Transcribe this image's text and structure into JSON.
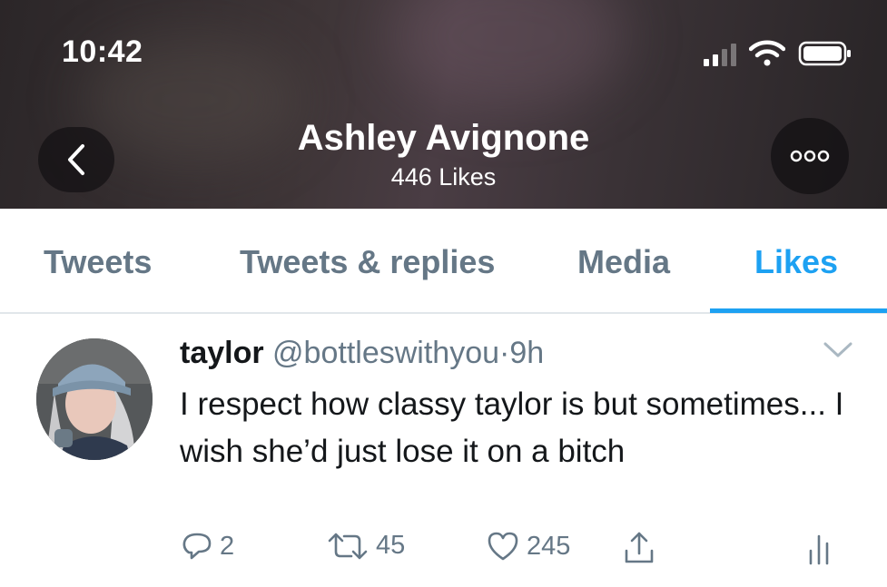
{
  "status_bar": {
    "time": "10:42"
  },
  "header": {
    "profile_name": "Ashley Avignone",
    "likes_count": "446 Likes"
  },
  "tabs": [
    {
      "label": "Tweets",
      "active": false
    },
    {
      "label": "Tweets & replies",
      "active": false
    },
    {
      "label": "Media",
      "active": false
    },
    {
      "label": "Likes",
      "active": true
    }
  ],
  "tweet": {
    "author_name": "taylor",
    "handle": "@bottleswithyou",
    "separator": "·",
    "time": "9h",
    "text": "I respect how classy taylor is but sometimes... I wish she’d just lose it on a bitch",
    "reply_count": "2",
    "retweet_count": "45",
    "like_count": "245"
  },
  "colors": {
    "accent": "#1da1f2",
    "secondary_text": "#657786",
    "primary_text": "#14171a"
  },
  "icons": [
    "back-arrow-icon",
    "more-dots-icon",
    "signal-icon",
    "wifi-icon",
    "battery-icon",
    "caret-down-icon",
    "reply-icon",
    "retweet-icon",
    "like-heart-icon",
    "share-icon",
    "analytics-icon"
  ]
}
